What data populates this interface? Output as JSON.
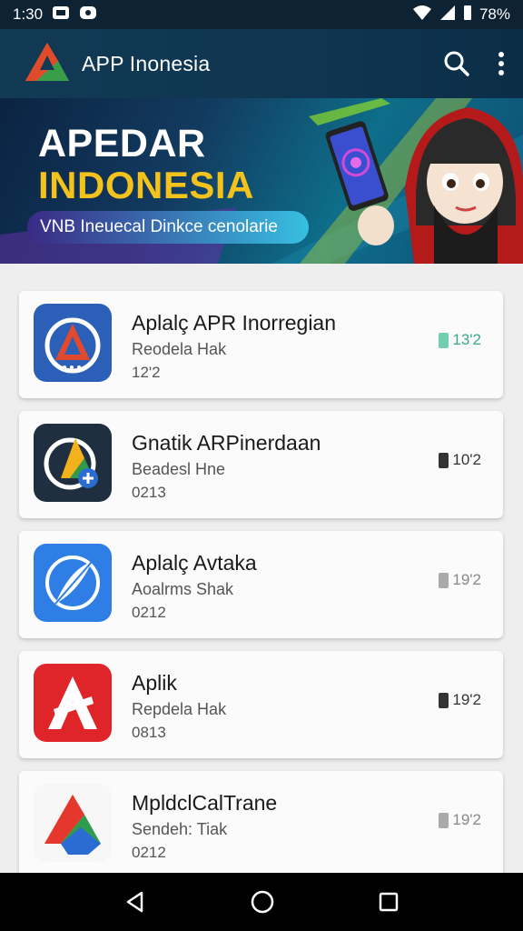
{
  "status_bar": {
    "time": "1:30",
    "battery": "78%"
  },
  "app_bar": {
    "title": "APP Inonesia"
  },
  "banner": {
    "title_line1": "APEDAR",
    "title_line2": "INDONESIA",
    "subtitle": "VNB Ineuecal  Dinkce cenolarie"
  },
  "apps": [
    {
      "title": "Aplalç APR Inorregian",
      "subtitle": "Reodela Hak",
      "number": "12'2",
      "badge": "13'2",
      "badge_color": "#6fcfb0",
      "icon": "red-a-logo-icon"
    },
    {
      "title": "Gnatik ARPinerdaan",
      "subtitle": "Beadesl Hne",
      "number": "0213",
      "badge": "10'2",
      "badge_color": "#333333",
      "icon": "colorful-a-plus-icon"
    },
    {
      "title": "Aplalç Avtaka",
      "subtitle": "Aoalrms Shak",
      "number": "0212",
      "badge": "19'2",
      "badge_color": "#999999",
      "icon": "blue-feather-icon"
    },
    {
      "title": "Aplik",
      "subtitle": "Repdela Hak",
      "number": "0813",
      "badge": "19'2",
      "badge_color": "#333333",
      "icon": "red-a-icon"
    },
    {
      "title": "MpldclCalTrane",
      "subtitle": "Sendeh: Tiak",
      "number": "0212",
      "badge": "19'2",
      "badge_color": "#999999",
      "icon": "drive-triangle-icon"
    }
  ]
}
